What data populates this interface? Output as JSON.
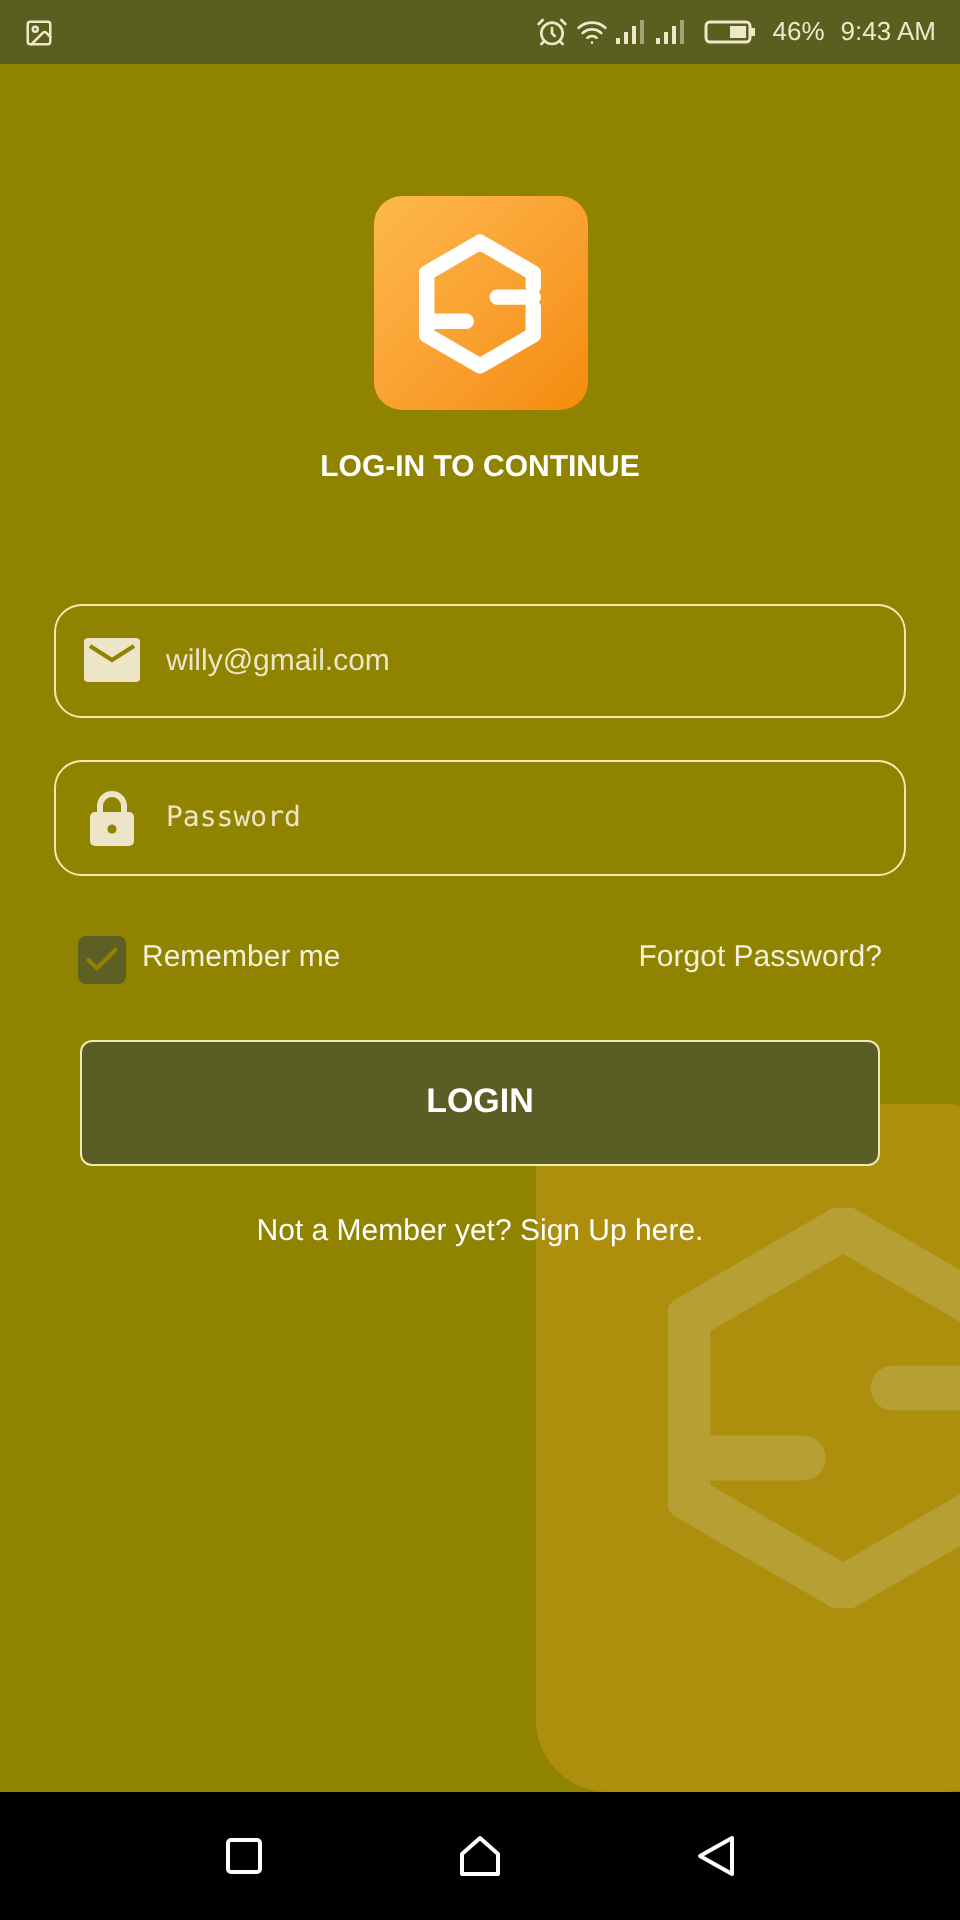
{
  "status_bar": {
    "battery": "46%",
    "time": "9:43 AM"
  },
  "title": "LOG-IN TO CONTINUE",
  "email_field": {
    "value": "willy@gmail.com"
  },
  "password_field": {
    "placeholder": "Password"
  },
  "remember": {
    "label": "Remember me",
    "checked": true
  },
  "forgot_link": "Forgot Password?",
  "login_button": "LOGIN",
  "signup_text": "Not a Member yet? Sign Up here."
}
